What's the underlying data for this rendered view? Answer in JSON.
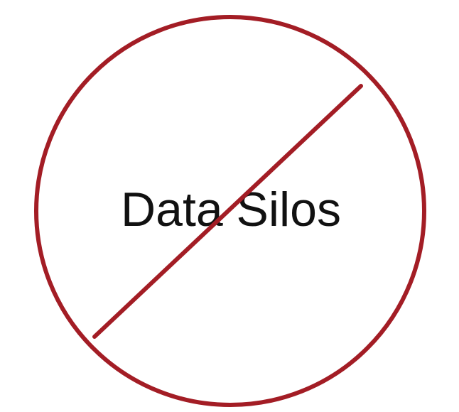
{
  "text": "Data Silos",
  "colors": {
    "background": "#ffffff",
    "symbol": "#a31d25",
    "text": "#111111"
  },
  "icon": "prohibition-sign-icon"
}
